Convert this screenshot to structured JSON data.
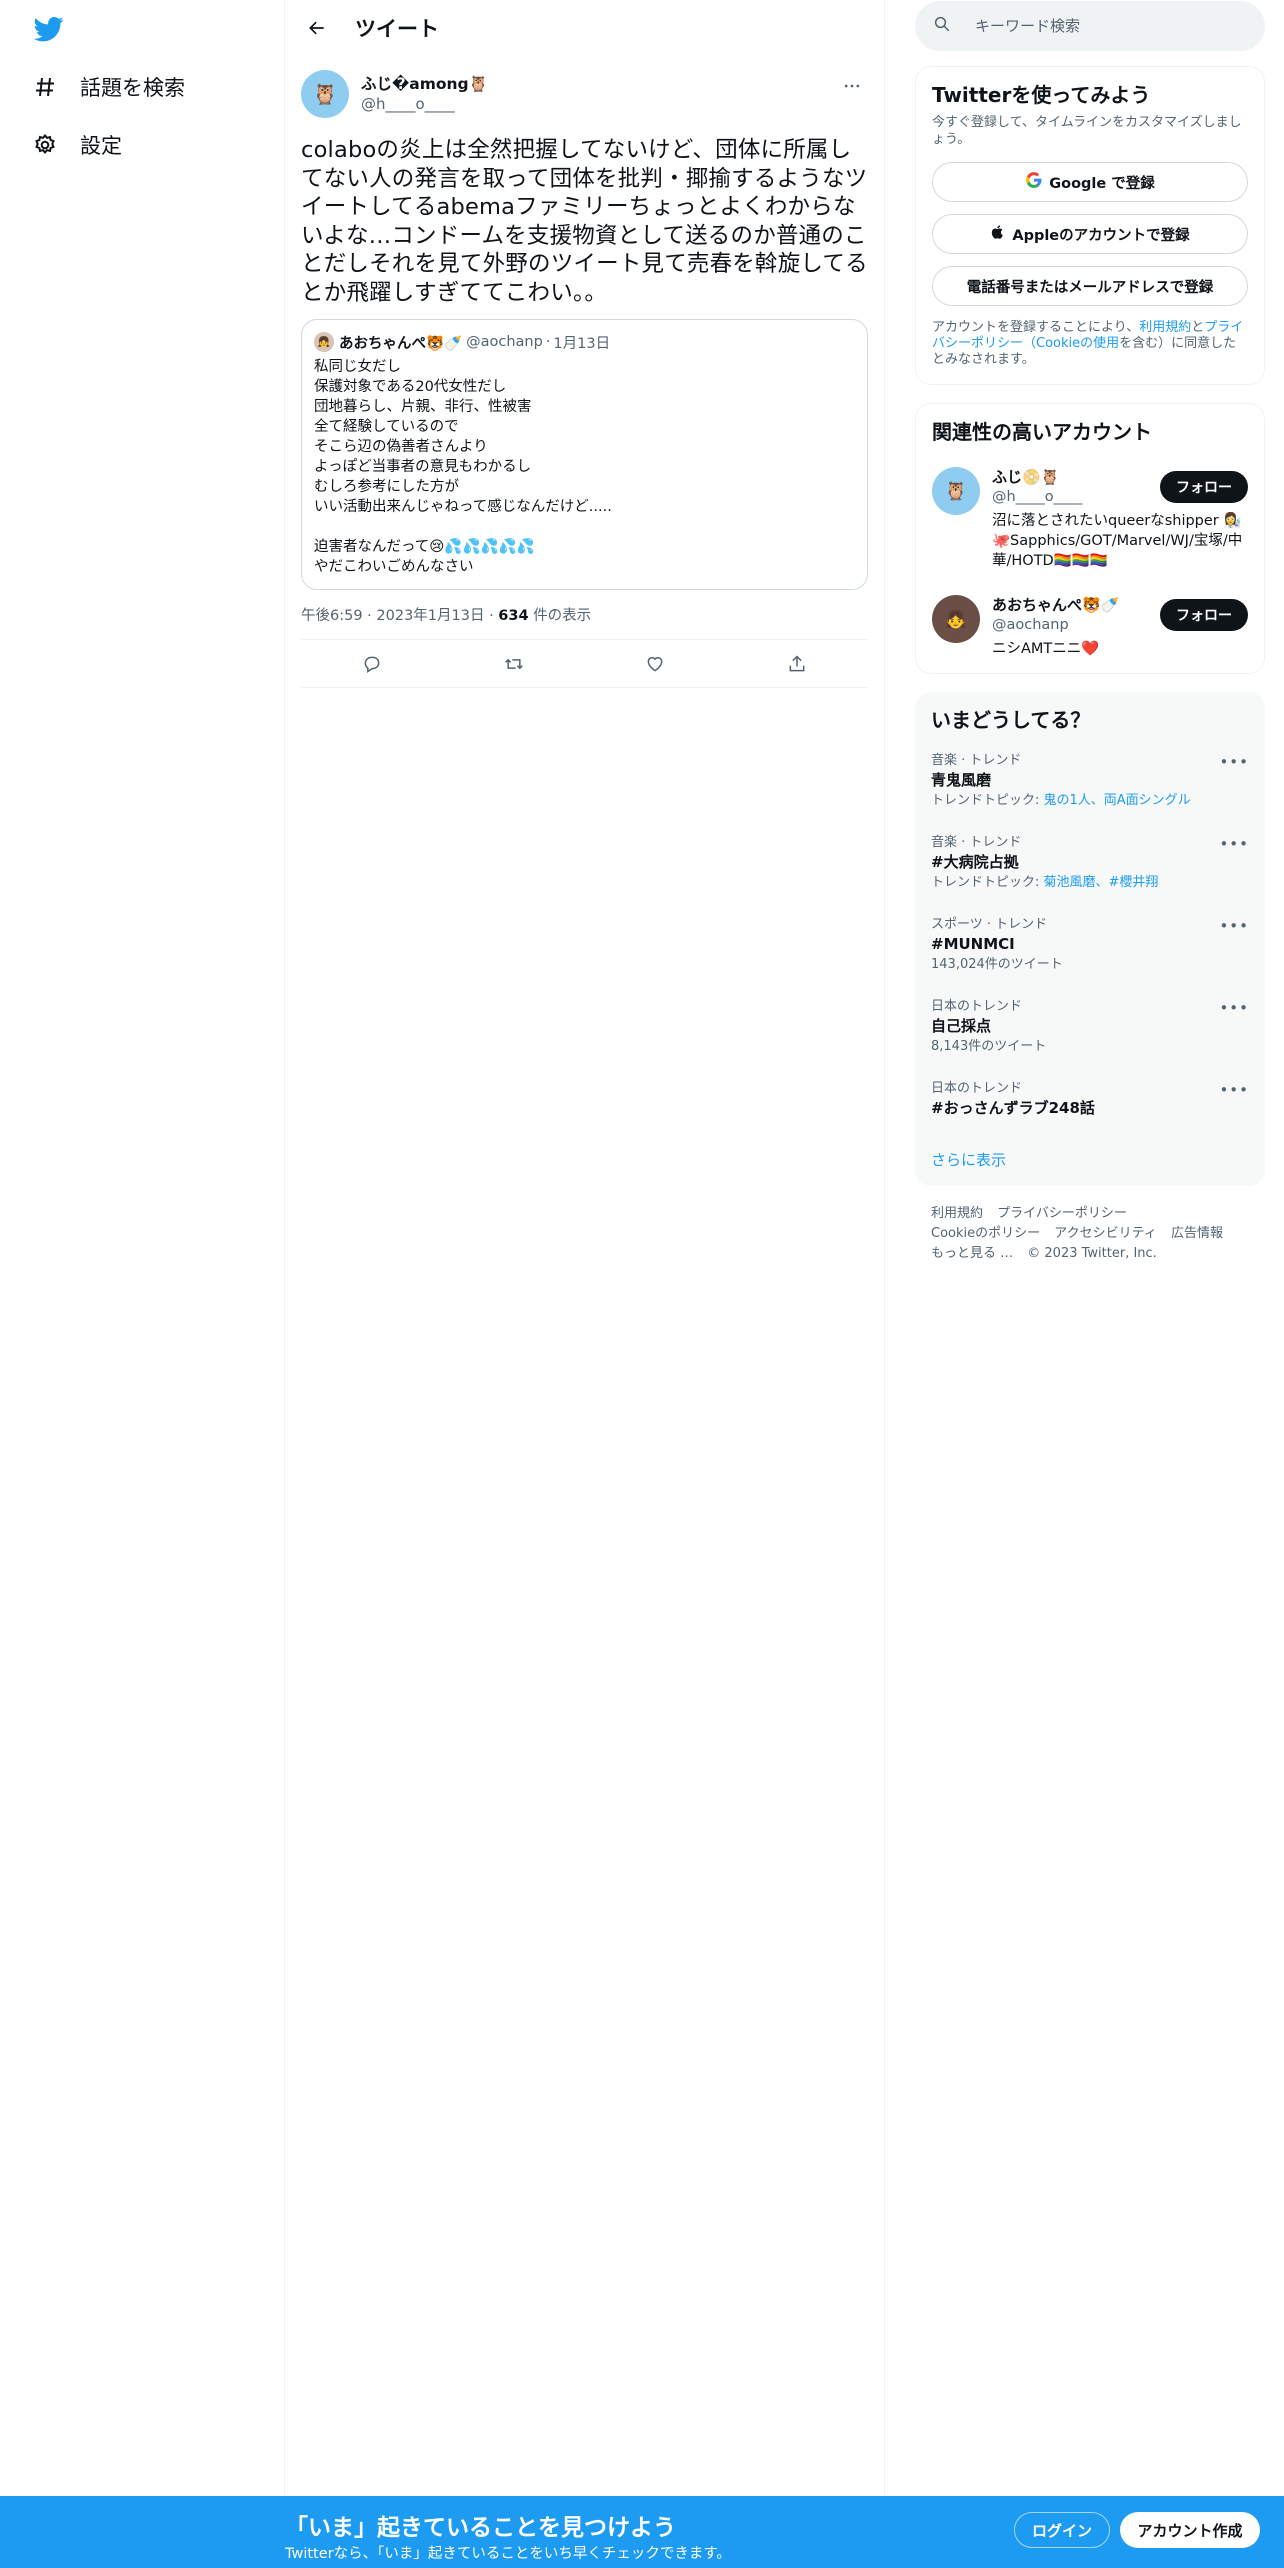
{
  "colors": {
    "brand": "#1d9bf0",
    "text": "#0f1419",
    "secondary": "#536471"
  },
  "nav": {
    "logo_icon": "twitter-bird-icon",
    "items": [
      {
        "label": "話題を検索",
        "icon": "hashtag-icon"
      },
      {
        "label": "設定",
        "icon": "gear-icon"
      }
    ]
  },
  "header": {
    "title": "ツイート"
  },
  "tweet": {
    "author_name": "ふじ�among🦉",
    "author_handle": "@h____o____",
    "text": "colaboの炎上は全然把握してないけど、団体に所属してない人の発言を取って団体を批判・揶揄するようなツイートしてるabemaファミリーちょっとよくわからないよな…コンドームを支援物資として送るのか普通のことだしそれを見て外野のツイート見て売春を斡旋してるとか飛躍しすぎててこわい。。",
    "quote": {
      "name": "あおちゃんぺ🐯🍼",
      "handle": "@aochanp",
      "sep": "·",
      "date": "1月13日",
      "body": "私同じ女だし\n保護対象である20代女性だし\n団地暮らし、片親、非行、性被害\n全て経験しているので\nそこら辺の偽善者さんより\nよっぽど当事者の意見もわかるし\nむしろ参考にした方が\nいい活動出来んじゃねって感じなんだけど.....\n\n迫害者なんだって😢💦💦💦💦💦\nやだこわいごめんなさい"
    },
    "time": "午後6:59",
    "date": "2023年1月13日",
    "views_count": "634",
    "views_label": "件の表示"
  },
  "search": {
    "placeholder": "キーワード検索"
  },
  "signup_card": {
    "title": "Twitterを使ってみよう",
    "subtitle": "今すぐ登録して、タイムラインをカスタマイズしましょう。",
    "google_label": "Google で登録",
    "apple_label": "Appleのアカウントで登録",
    "phone_label": "電話番号またはメールアドレスで登録",
    "legal_pre": "アカウントを登録することにより、",
    "legal_terms": "利用規約",
    "legal_and": "と",
    "legal_privacy": "プライバシーポリシー",
    "legal_paren_open": "（",
    "legal_cookie": "Cookieの使用",
    "legal_post": "を含む）に同意したとみなされます。"
  },
  "related": {
    "title": "関連性の高いアカウント",
    "accounts": [
      {
        "name": "ふじ📀🦉",
        "handle": "@h____o____",
        "bio": "沼に落とされたいqueerなshipper 👩‍🔬🐙Sapphics/GOT/Marvel/WJ/宝塚/中華/HOTD🏳️‍🌈🏳️‍🌈🏳️‍🌈",
        "follow_label": "フォロー"
      },
      {
        "name": "あおちゃんぺ🐯🍼",
        "handle": "@aochanp",
        "bio": "ニシAMTニニ❤️",
        "follow_label": "フォロー"
      }
    ]
  },
  "trends": {
    "title": "いまどうしてる？",
    "items": [
      {
        "category": "音楽 · トレンド",
        "name": "青鬼風磨",
        "meta_label": "トレンドトピック: ",
        "meta_links": "鬼の1人、両A面シングル"
      },
      {
        "category": "音楽 · トレンド",
        "name": "#大病院占拠",
        "meta_label": "トレンドトピック: ",
        "meta_links": "菊池風磨、#櫻井翔"
      },
      {
        "category": "スポーツ · トレンド",
        "name": "#MUNMCI",
        "meta_label": "143,024件のツイート",
        "meta_links": ""
      },
      {
        "category": "日本のトレンド",
        "name": "自己採点",
        "meta_label": "8,143件のツイート",
        "meta_links": ""
      },
      {
        "category": "日本のトレンド",
        "name": "#おっさんずラブ248話",
        "meta_label": "",
        "meta_links": ""
      }
    ],
    "show_more": "さらに表示"
  },
  "footer": {
    "links": [
      "利用規約",
      "プライバシーポリシー",
      "Cookieのポリシー",
      "アクセシビリティ",
      "広告情報",
      "もっと見る …"
    ],
    "copyright": "© 2023 Twitter, Inc."
  },
  "bottom_bar": {
    "title": "「いま」起きていることを見つけよう",
    "subtitle": "Twitterなら、「いま」起きていることをいち早くチェックできます。",
    "login_label": "ログイン",
    "signup_label": "アカウント作成"
  }
}
